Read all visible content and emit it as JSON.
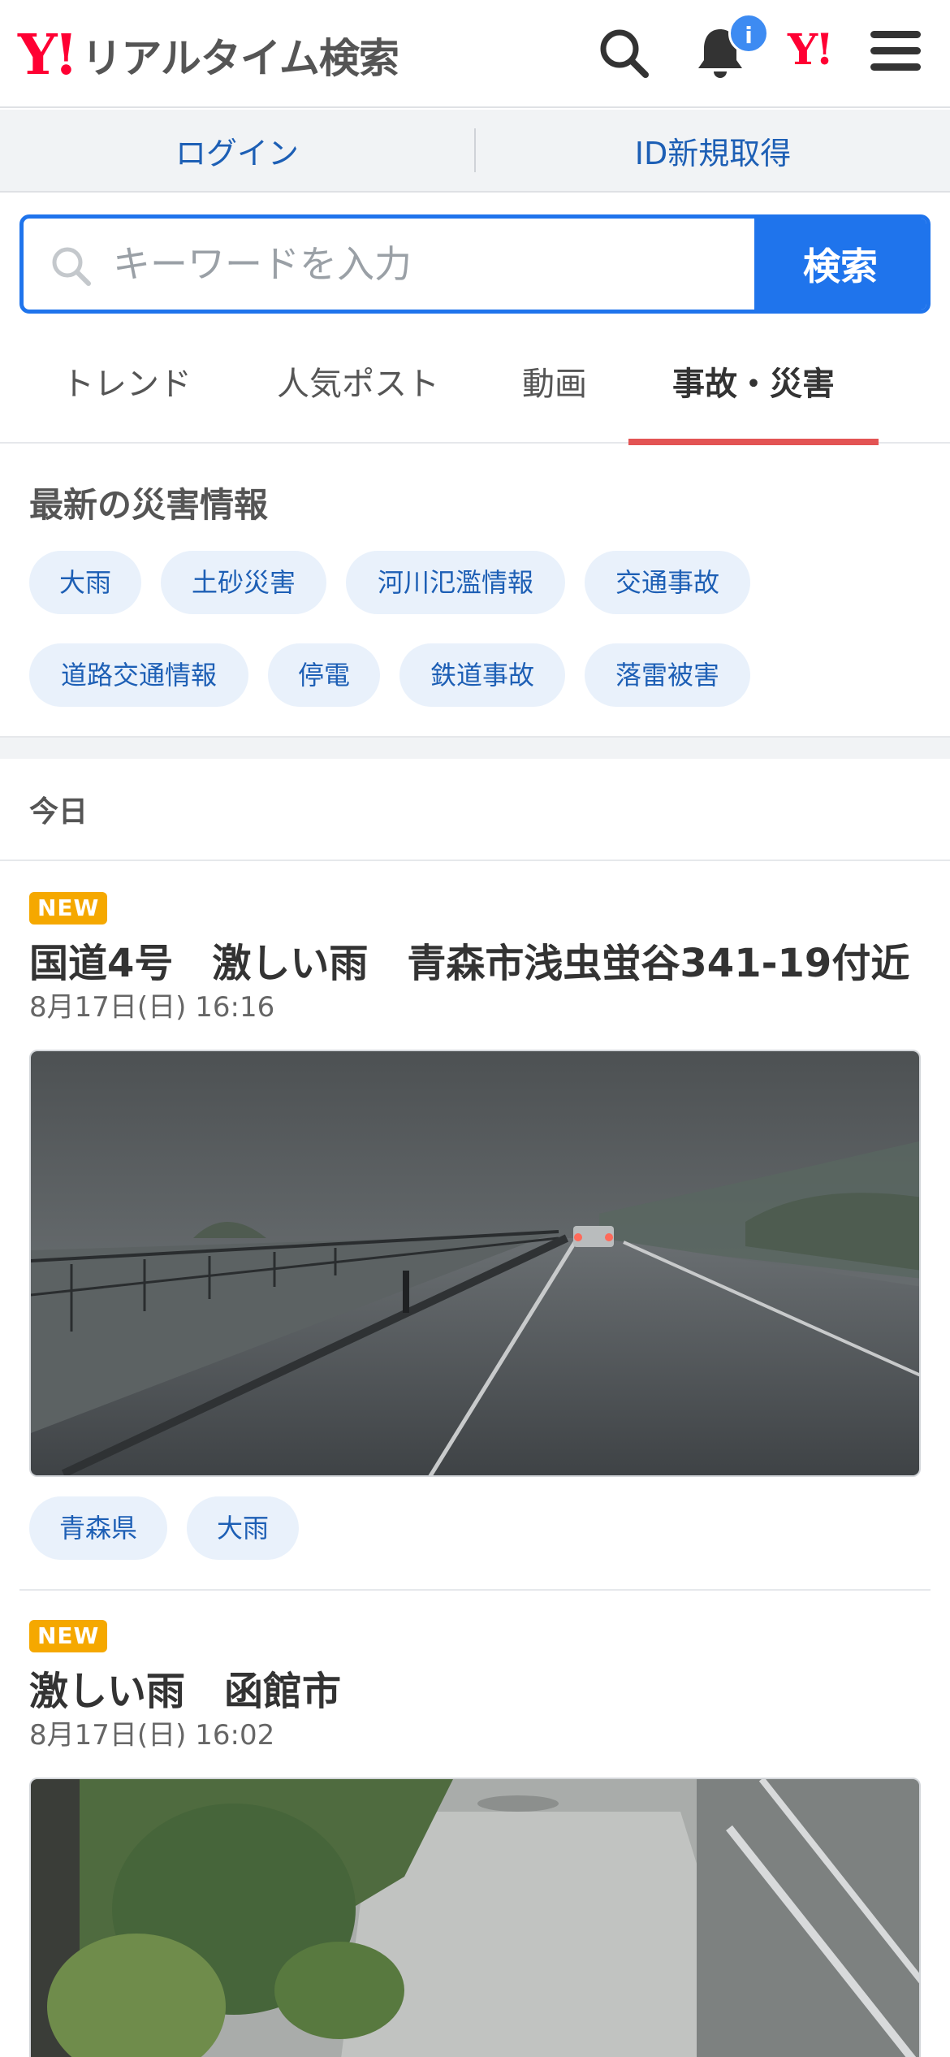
{
  "header": {
    "logo_mark": "Y!",
    "logo_text": "リアルタイム検索",
    "notification_badge": "i",
    "yahoo_mark": "Y!"
  },
  "account": {
    "login_label": "ログイン",
    "register_label": "ID新規取得"
  },
  "search": {
    "placeholder": "キーワードを入力",
    "button_label": "検索"
  },
  "tabs": [
    {
      "label": "トレンド",
      "active": false
    },
    {
      "label": "人気ポスト",
      "active": false
    },
    {
      "label": "動画",
      "active": false
    },
    {
      "label": "事故・災害",
      "active": true
    }
  ],
  "disaster": {
    "title": "最新の災害情報",
    "chips": [
      "大雨",
      "土砂災害",
      "河川氾濫情報",
      "交通事故",
      "道路交通情報",
      "停電",
      "鉄道事故",
      "落雷被害"
    ]
  },
  "today_label": "今日",
  "articles": [
    {
      "badge": "NEW",
      "title": "国道4号　激しい雨　青森市浅虫蛍谷341-19付近",
      "date": "8月17日(日) 16:16",
      "tags": [
        "青森県",
        "大雨"
      ]
    },
    {
      "badge": "NEW",
      "title": "激しい雨　函館市",
      "date": "8月17日(日) 16:02"
    }
  ],
  "colors": {
    "accent_blue": "#1f74ec",
    "link_blue": "#1d5fb5",
    "yahoo_red": "#ff0033",
    "tab_indicator": "#e35454",
    "new_badge": "#f5a800"
  }
}
